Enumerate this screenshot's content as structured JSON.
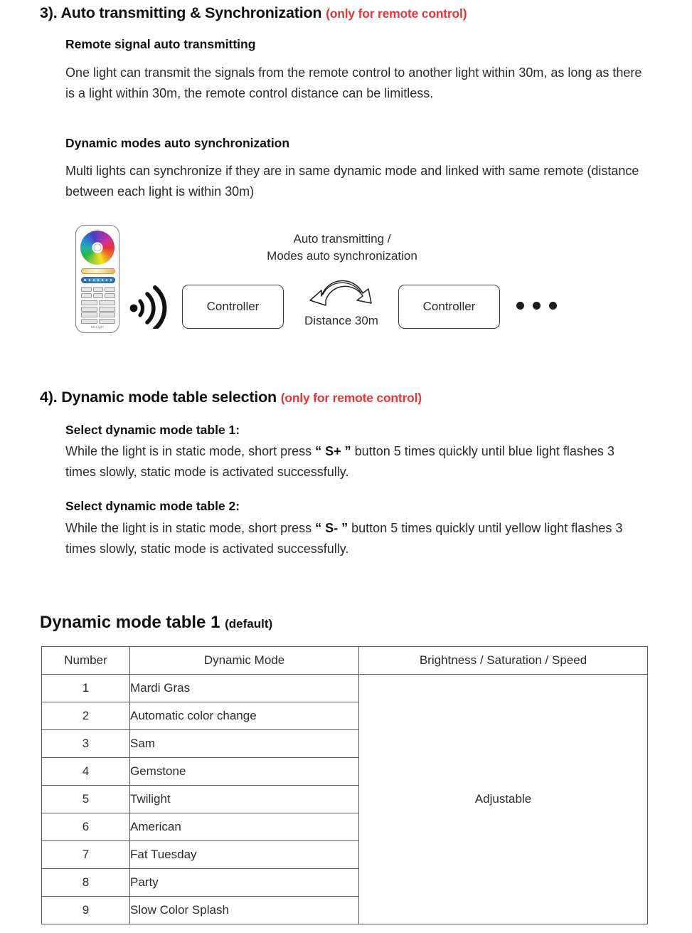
{
  "sections": [
    {
      "number": "3).",
      "title": "Auto transmitting & Synchronization",
      "note": "(only for remote control)",
      "sub1_heading": "Remote signal auto transmitting",
      "sub1_body": "One light can transmit the signals from the remote control to another light within 30m, as long as there is a light within 30m, the remote control distance can be limitless.",
      "sub2_heading": "Dynamic modes auto synchronization",
      "sub2_body": "Multi lights can synchronize if they are in same dynamic mode and linked with same remote (distance between each light is within 30m)"
    },
    {
      "number": "4).",
      "title": "Dynamic mode table selection",
      "note": "(only for remote control)",
      "sub1_heading": "Select dynamic mode table 1:",
      "sub1_body_pre": "While the light is in static mode, short press ",
      "sub1_body_key": "“ S+ ”",
      "sub1_body_post": " button 5 times quickly until blue light flashes 3 times slowly, static mode is activated successfully.",
      "sub2_heading": "Select dynamic mode table 2:",
      "sub2_body_pre": "While the light is in static mode, short press ",
      "sub2_body_key": "“ S- ”",
      "sub2_body_post": " button 5 times quickly until yellow light flashes 3 times slowly, static mode is activated successfully."
    }
  ],
  "diagram": {
    "remote_logo": "Mi·Light",
    "caption_line1": "Auto transmitting /",
    "caption_line2": "Modes auto synchronization",
    "controller_left": "Controller",
    "controller_right": "Controller",
    "distance_label": "Distance 30m"
  },
  "table": {
    "title_main": "Dynamic mode table 1",
    "title_note": "(default)",
    "headers": [
      "Number",
      "Dynamic Mode",
      "Brightness / Saturation / Speed"
    ],
    "merged_value": "Adjustable",
    "rows": [
      {
        "number": "1",
        "mode": "Mardi Gras"
      },
      {
        "number": "2",
        "mode": "Automatic color change"
      },
      {
        "number": "3",
        "mode": "Sam"
      },
      {
        "number": "4",
        "mode": "Gemstone"
      },
      {
        "number": "5",
        "mode": "Twilight"
      },
      {
        "number": "6",
        "mode": "American"
      },
      {
        "number": "7",
        "mode": "Fat Tuesday"
      },
      {
        "number": "8",
        "mode": "Party"
      },
      {
        "number": "9",
        "mode": "Slow Color Splash"
      }
    ]
  },
  "colors": {
    "accent_red": "#e4373c",
    "text": "#1a1a1a",
    "border": "#585858"
  }
}
